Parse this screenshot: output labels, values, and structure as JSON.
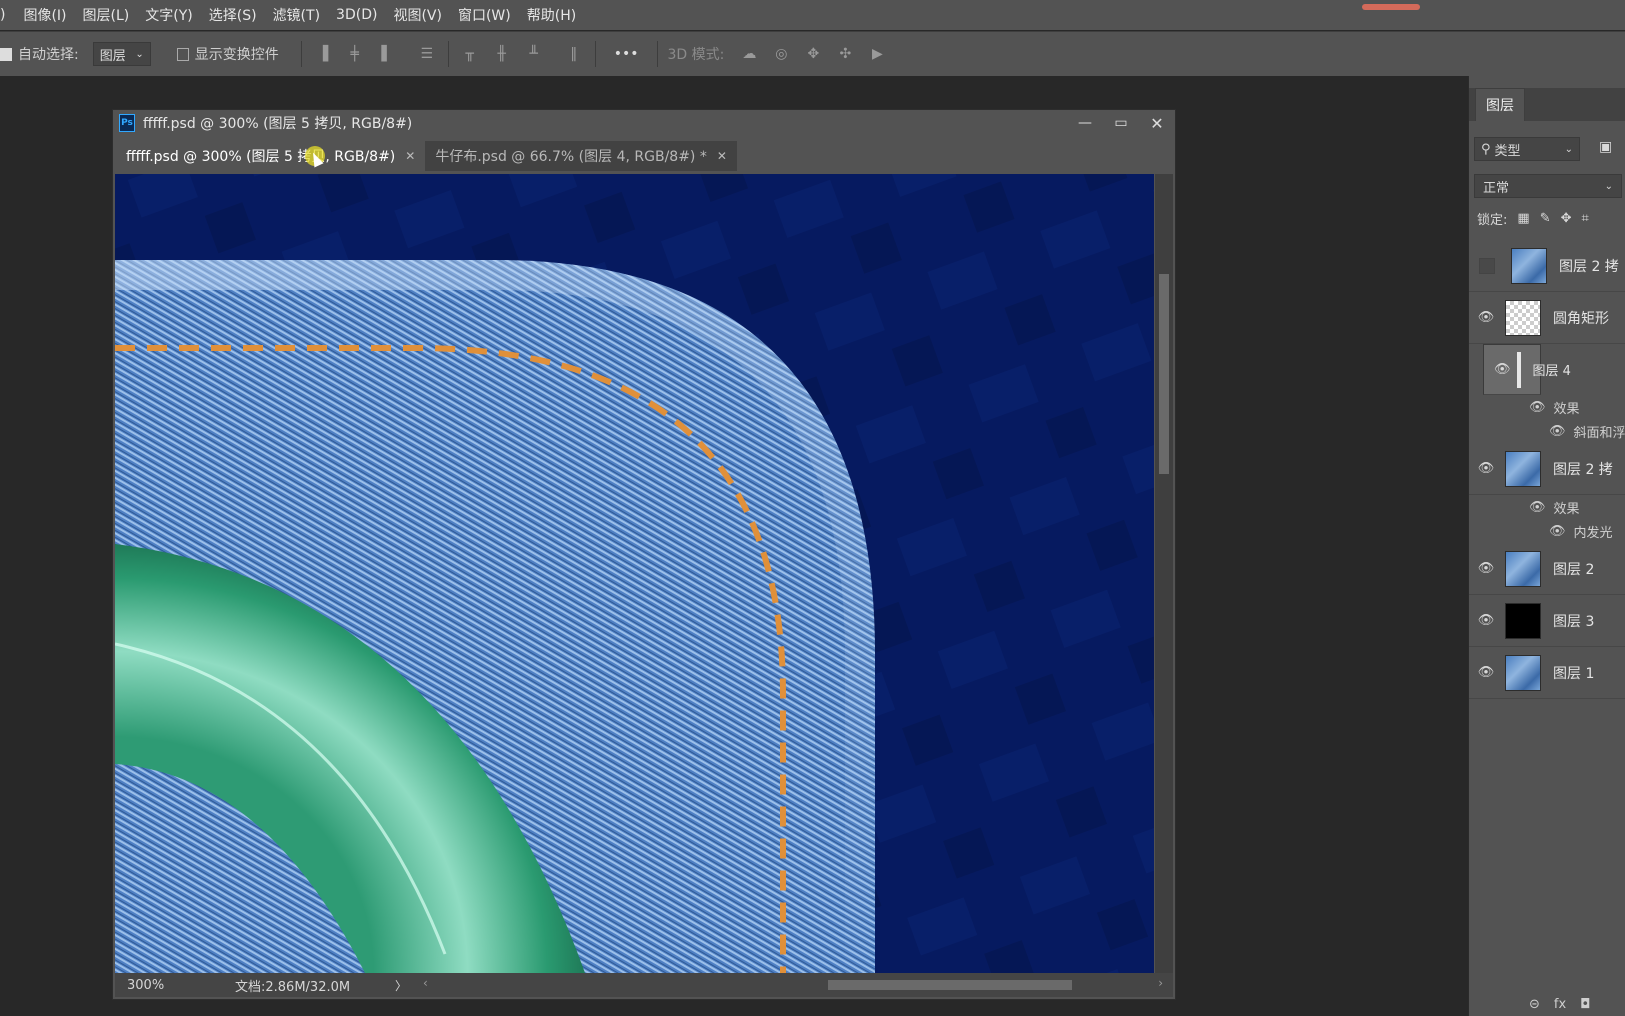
{
  "menu": {
    "items": [
      ")",
      "图像(I)",
      "图层(L)",
      "文字(Y)",
      "选择(S)",
      "滤镜(T)",
      "3D(D)",
      "视图(V)",
      "窗口(W)",
      "帮助(H)"
    ]
  },
  "options_bar": {
    "auto_select_label": "自动选择:",
    "auto_select_value": "图层",
    "show_transform_label": "显示变换控件",
    "more_label": "•••",
    "mode_3d_label": "3D 模式:"
  },
  "document": {
    "title": "fffff.psd @ 300% (图层 5 拷贝, RGB/8#)",
    "tabs": [
      {
        "label": "fffff.psd @ 300% (图层 5 拷贝, RGB/8#)",
        "active": true
      },
      {
        "label": "牛仔布.psd @ 66.7% (图层 4, RGB/8#) *",
        "active": false
      }
    ],
    "zoom": "300%",
    "doc_info": "文档:2.86M/32.0M",
    "status_arrow": "〉"
  },
  "layers_panel": {
    "tab_label": "图层",
    "filter_label": "类型",
    "blend_mode": "正常",
    "lock_label": "锁定:",
    "layers": [
      {
        "name": "图层 2 拷",
        "thumb": "denim",
        "visible": false
      },
      {
        "name": "圆角矩形",
        "thumb": "checker",
        "visible": true
      },
      {
        "name": "图层 4",
        "thumb": "checker",
        "visible": true,
        "selected": true,
        "effects_label": "效果",
        "effect": "斜面和浮"
      },
      {
        "name": "图层 2 拷",
        "thumb": "denim",
        "visible": true,
        "effects_label": "效果",
        "effect": "内发光"
      },
      {
        "name": "图层 2",
        "thumb": "denim",
        "visible": true
      },
      {
        "name": "图层 3",
        "thumb": "black",
        "visible": true
      },
      {
        "name": "图层 1",
        "thumb": "denim",
        "visible": true
      }
    ],
    "bottom": [
      "⊝",
      "fx",
      "◘"
    ]
  },
  "colors": {
    "canvas_bg": "#061a60",
    "denim": "#5d8ed0",
    "stitch": "#e0903a",
    "ring": "#3fb08a"
  }
}
